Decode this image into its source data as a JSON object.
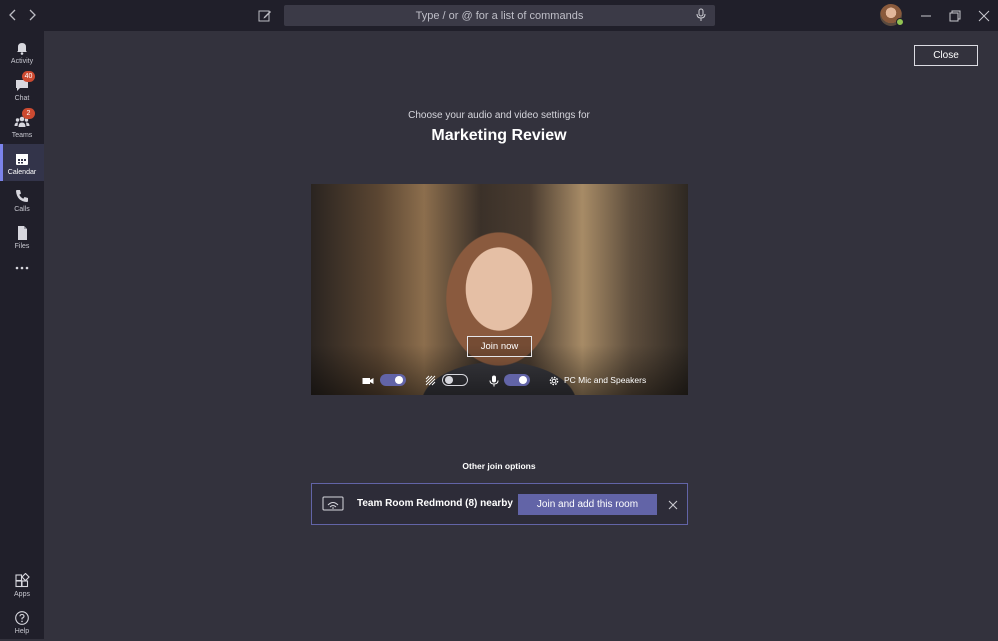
{
  "titlebar": {
    "back_icon": "chevron-left-icon",
    "forward_icon": "chevron-right-icon",
    "compose_icon": "compose-icon",
    "search_placeholder": "Type / or @ for a list of commands",
    "mic_icon": "microphone-icon",
    "window_controls": [
      "minimize-icon",
      "restore-icon",
      "close-icon"
    ]
  },
  "rail": {
    "items": [
      {
        "label": "Activity",
        "icon": "bell-icon"
      },
      {
        "label": "Chat",
        "icon": "chat-icon",
        "badge": "40"
      },
      {
        "label": "Teams",
        "icon": "teams-icon",
        "badge": "2"
      },
      {
        "label": "Calendar",
        "icon": "calendar-icon",
        "active": true
      },
      {
        "label": "Calls",
        "icon": "phone-icon"
      },
      {
        "label": "Files",
        "icon": "file-icon"
      }
    ],
    "more_icon": "ellipsis-icon",
    "bottom": [
      {
        "label": "Apps",
        "icon": "apps-icon"
      },
      {
        "label": "Help",
        "icon": "help-icon"
      }
    ]
  },
  "main": {
    "close_label": "Close",
    "subtitle": "Choose your audio and video settings for",
    "meeting_title": "Marketing Review",
    "preview": {
      "join_label": "Join now",
      "camera_on": true,
      "background_blur_on": false,
      "mic_on": true,
      "device_label": "PC Mic and Speakers"
    },
    "other_join_label": "Other join options",
    "room": {
      "name": "Team Room Redmond (8) nearby",
      "join_label": "Join and add this room"
    }
  },
  "colors": {
    "accent": "#6264a7",
    "background": "#33323d",
    "rail": "#201f2a",
    "badge": "#cc4a31",
    "presence": "#92c353"
  }
}
